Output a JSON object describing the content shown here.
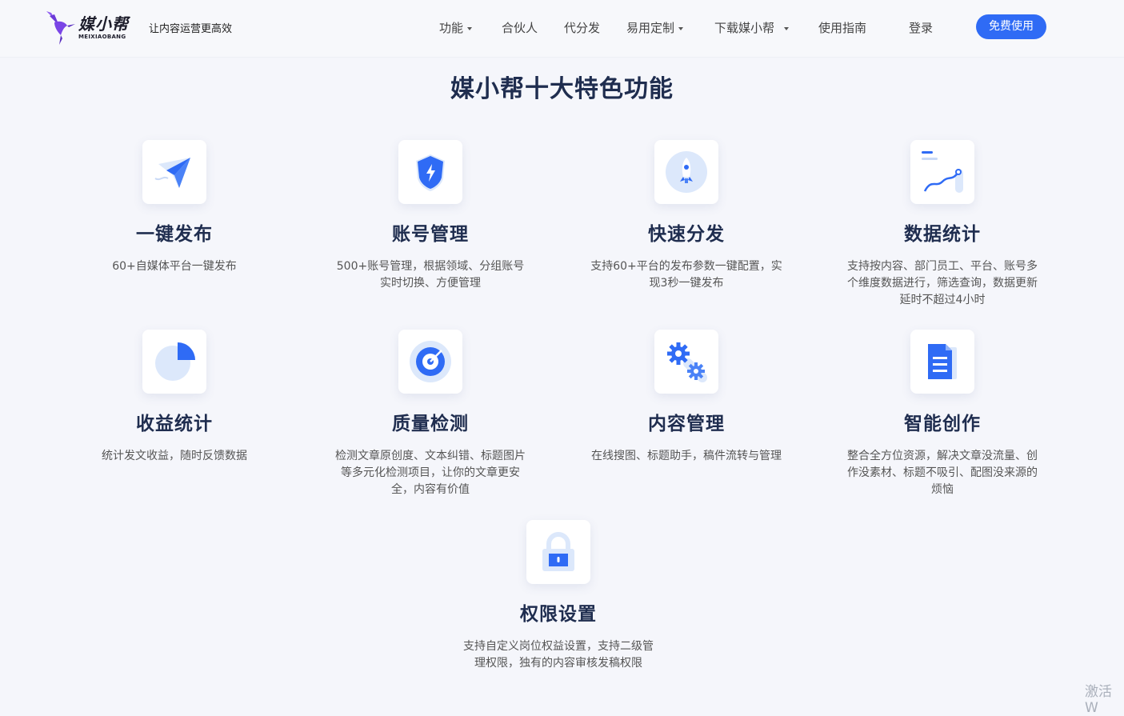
{
  "header": {
    "logo_cn": "媒小帮",
    "logo_en": "MEIXIAOBANG",
    "slogan": "让内容运营更高效",
    "nav": [
      {
        "label": "功能",
        "dropdown": true
      },
      {
        "label": "合伙人",
        "dropdown": false
      },
      {
        "label": "代分发",
        "dropdown": false
      },
      {
        "label": "易用定制",
        "dropdown": true
      },
      {
        "label": "下载媒小帮",
        "dropdown": true
      },
      {
        "label": "使用指南",
        "dropdown": false
      },
      {
        "label": "登录",
        "dropdown": false
      }
    ],
    "cta": "免费使用"
  },
  "section": {
    "title": "媒小帮十大特色功能",
    "features": [
      {
        "icon": "paper-plane-icon",
        "title": "一键发布",
        "desc": "60+自媒体平台一键发布"
      },
      {
        "icon": "shield-icon",
        "title": "账号管理",
        "desc": "500+账号管理，根据领域、分组账号实时切换、方便管理"
      },
      {
        "icon": "rocket-icon",
        "title": "快速分发",
        "desc": "支持60+平台的发布参数一键配置，实现3秒一键发布"
      },
      {
        "icon": "line-chart-icon",
        "title": "数据统计",
        "desc": "支持按内容、部门员工、平台、账号多个维度数据进行，筛选查询，数据更新延时不超过4小时"
      },
      {
        "icon": "pie-chart-icon",
        "title": "收益统计",
        "desc": "统计发文收益，随时反馈数据"
      },
      {
        "icon": "target-icon",
        "title": "质量检测",
        "desc": "检测文章原创度、文本纠错、标题图片等多元化检测项目，让你的文章更安全，内容有价值"
      },
      {
        "icon": "gears-icon",
        "title": "内容管理",
        "desc": "在线搜图、标题助手，稿件流转与管理"
      },
      {
        "icon": "document-icon",
        "title": "智能创作",
        "desc": "整合全方位资源，解决文章没流量、创作没素材、标题不吸引、配图没来源的烦恼"
      },
      {
        "icon": "lock-icon",
        "title": "权限设置",
        "desc": "支持自定义岗位权益设置，支持二级管理权限，独有的内容审核发稿权限"
      }
    ]
  },
  "watermark": "激活 W",
  "colors": {
    "accent": "#2f6bf5",
    "title": "#1f2d4f",
    "icon_blue": "#2f6bf5",
    "icon_light": "#dce8fb"
  }
}
